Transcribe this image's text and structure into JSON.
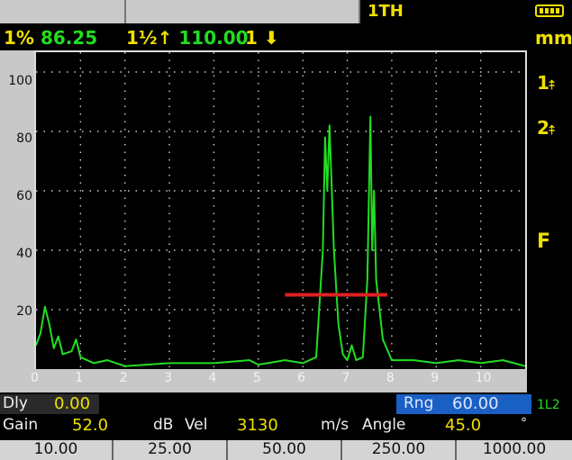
{
  "header": {
    "mode": "1TH",
    "units": "mm",
    "readouts": [
      {
        "prefix": "1%",
        "value": "86.25"
      },
      {
        "prefix": "1½↑",
        "value": "110.00"
      },
      {
        "prefix": "1",
        "icon": "gate-down-arrow-icon"
      }
    ]
  },
  "right_icons": [
    {
      "label": "1",
      "icon": "gate-1-peak-icon"
    },
    {
      "label": "2",
      "icon": "gate-2-peak-icon"
    },
    {
      "label": "F"
    }
  ],
  "axes": {
    "y_ticks": [
      "100",
      "80",
      "60",
      "40",
      "20"
    ],
    "x_ticks": [
      "0",
      "1",
      "2",
      "3",
      "4",
      "5",
      "6",
      "7",
      "8",
      "9",
      "10"
    ]
  },
  "chart_data": {
    "type": "line",
    "ylim": [
      0,
      100
    ],
    "xlim": [
      0,
      11
    ],
    "grid": true,
    "series": [
      {
        "color": "#22dd22",
        "points": [
          [
            0,
            8
          ],
          [
            0.1,
            12
          ],
          [
            0.2,
            21
          ],
          [
            0.3,
            15
          ],
          [
            0.4,
            7
          ],
          [
            0.5,
            11
          ],
          [
            0.6,
            5
          ],
          [
            0.8,
            6
          ],
          [
            0.9,
            10
          ],
          [
            1.0,
            4
          ],
          [
            1.3,
            2
          ],
          [
            1.6,
            3
          ],
          [
            2,
            1
          ],
          [
            3,
            2
          ],
          [
            4,
            2
          ],
          [
            4.8,
            3
          ],
          [
            5.0,
            1.5
          ],
          [
            5.6,
            3
          ],
          [
            6.0,
            2
          ],
          [
            6.3,
            4
          ],
          [
            6.45,
            40
          ],
          [
            6.5,
            78
          ],
          [
            6.55,
            60
          ],
          [
            6.6,
            82
          ],
          [
            6.7,
            40
          ],
          [
            6.8,
            15
          ],
          [
            6.9,
            5
          ],
          [
            7.0,
            3
          ],
          [
            7.1,
            8
          ],
          [
            7.2,
            3
          ],
          [
            7.35,
            4
          ],
          [
            7.45,
            30
          ],
          [
            7.52,
            85
          ],
          [
            7.56,
            40
          ],
          [
            7.6,
            60
          ],
          [
            7.65,
            30
          ],
          [
            7.8,
            10
          ],
          [
            8.0,
            3
          ],
          [
            8.5,
            3
          ],
          [
            9,
            2
          ],
          [
            9.5,
            3
          ],
          [
            10,
            2
          ],
          [
            10.5,
            3
          ],
          [
            11,
            1
          ]
        ]
      }
    ],
    "gate": {
      "color": "#dd2222",
      "start": 5.6,
      "end": 7.9,
      "level": 25
    }
  },
  "params": {
    "dly_label": "Dly",
    "dly_value": "0.00",
    "rng_label": "Rng",
    "rng_value": "60.00",
    "gain_label": "Gain",
    "gain_value": "52.0",
    "gain_unit": "dB",
    "vel_label": "Vel",
    "vel_value": "3130",
    "vel_unit": "m/s",
    "angle_label": "Angle",
    "angle_value": "45.0",
    "angle_unit": "°",
    "side_tag": "1L2"
  },
  "softkeys": [
    "10.00",
    "25.00",
    "50.00",
    "250.00",
    "1000.00"
  ]
}
